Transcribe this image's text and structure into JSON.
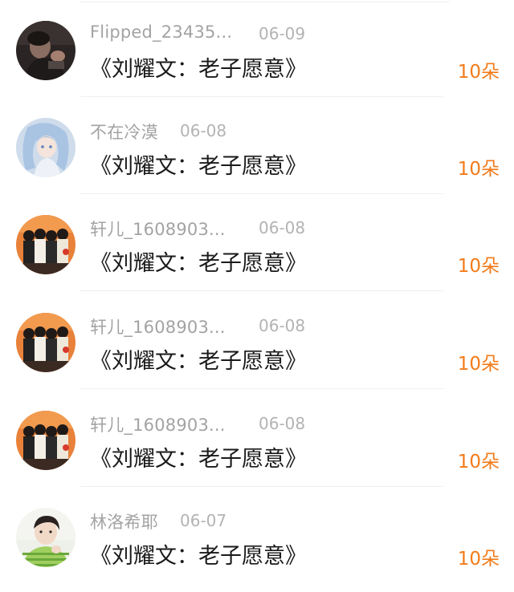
{
  "gifts": [
    {
      "username": "Flipped_23435...",
      "date": "06-09",
      "title": "《刘耀文：老子愿意》",
      "count": "10朵",
      "avatar": "dark-photo"
    },
    {
      "username": "不在冷漠",
      "date": "06-08",
      "title": "《刘耀文：老子愿意》",
      "count": "10朵",
      "avatar": "anime-girl-blue-hair"
    },
    {
      "username": "轩儿_1608903...",
      "date": "06-08",
      "title": "《刘耀文：老子愿意》",
      "count": "10朵",
      "avatar": "group-photo"
    },
    {
      "username": "轩儿_1608903...",
      "date": "06-08",
      "title": "《刘耀文：老子愿意》",
      "count": "10朵",
      "avatar": "group-photo"
    },
    {
      "username": "轩儿_1608903...",
      "date": "06-08",
      "title": "《刘耀文：老子愿意》",
      "count": "10朵",
      "avatar": "group-photo"
    },
    {
      "username": "林洛希耶",
      "date": "06-07",
      "title": "《刘耀文：老子愿意》",
      "count": "10朵",
      "avatar": "boy-striped-shirt"
    }
  ],
  "colors": {
    "count": "#f27b1a",
    "username": "#a3a3a3",
    "title": "#1a1a1a"
  }
}
